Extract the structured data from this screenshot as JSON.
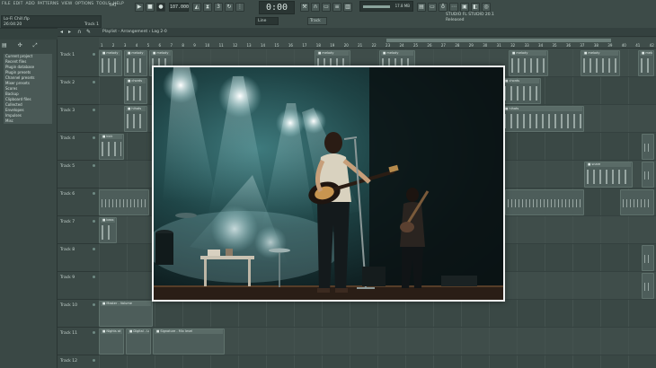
{
  "menu": [
    "FILE",
    "EDIT",
    "ADD",
    "PATTERNS",
    "VIEW",
    "OPTIONS",
    "TOOLS",
    "HELP"
  ],
  "hint": {
    "project": "Lo-Fi Chill.flp",
    "time": "26:04:20",
    "count": "Track 1"
  },
  "transport": {
    "pattern_label": "PAT",
    "tempo": "107.000",
    "timecode": "0:00",
    "snap": "Line",
    "pattern": "Track"
  },
  "cpu": {
    "value": "17.8 MB"
  },
  "news": {
    "line1": "STUDIO FL STUDIO 20.1",
    "line2": "Released"
  },
  "browser": {
    "tools": [
      "▤",
      "✣",
      "⤢"
    ],
    "items": [
      "Current project",
      "Recent files",
      "Plugin database",
      "Plugin presets",
      "Channel presets",
      "Mixer presets",
      "Scores",
      "Backup",
      "Clipboard files",
      "Collected",
      "Envelopes",
      "Impulses",
      "Misc"
    ]
  },
  "playlist": {
    "title": "Playlist - Arrangement › Lag 2-0",
    "ruler": [
      "1",
      "2",
      "3",
      "4",
      "5",
      "6",
      "7",
      "8",
      "9",
      "10",
      "11",
      "12",
      "13",
      "14",
      "15",
      "16",
      "17",
      "18",
      "19",
      "20",
      "21",
      "22",
      "23",
      "24",
      "25",
      "26",
      "27",
      "28",
      "29",
      "30",
      "31",
      "32",
      "33",
      "34",
      "35",
      "36",
      "37",
      "38",
      "39",
      "40",
      "41",
      "42"
    ],
    "tracks": [
      "Track 1",
      "Track 2",
      "Track 3",
      "Track 4",
      "Track 5",
      "Track 6",
      "Track 7",
      "Track 8",
      "Track 9",
      "Track 10",
      "Track 11",
      "Track 12"
    ]
  },
  "clips": {
    "a": "■ melody",
    "b": "■ chords",
    "c": "■ hihats",
    "d": "■ kick",
    "e": "■ snare",
    "f": "■ bass",
    "g": "■ Master - Volume",
    "h": "■ Nights at ∙∙∙",
    "i": "■ Digital - Level",
    "j": "■ Signature - Mix level"
  },
  "colors": {
    "accent": "#5a6b67",
    "background": "#34423f",
    "photo_frame": "#f1f3f2"
  },
  "photo": {
    "subject": "concert-guitarist-photo"
  }
}
